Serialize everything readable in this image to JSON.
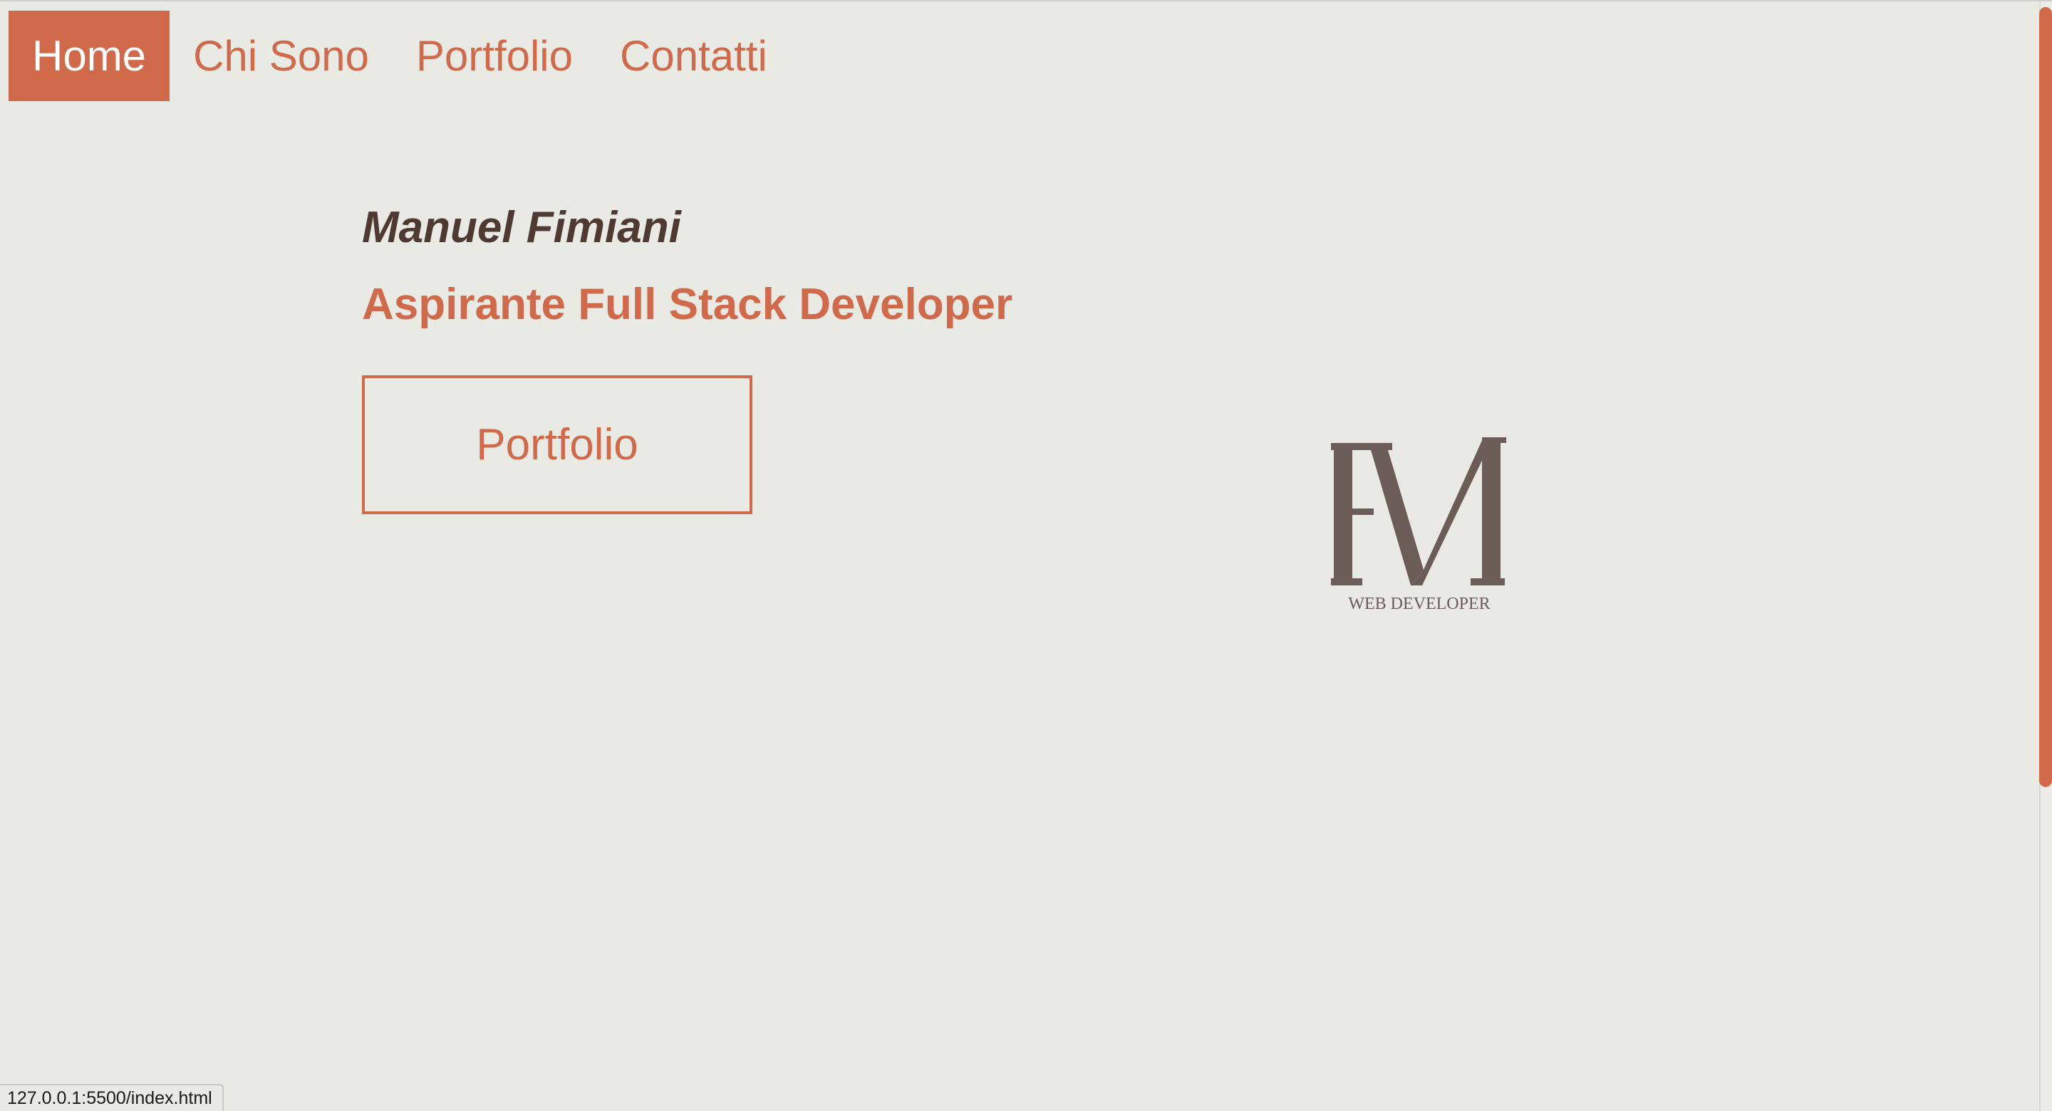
{
  "nav": {
    "items": [
      {
        "label": "Home",
        "active": true
      },
      {
        "label": "Chi Sono",
        "active": false
      },
      {
        "label": "Portfolio",
        "active": false
      },
      {
        "label": "Contatti",
        "active": false
      }
    ]
  },
  "hero": {
    "name": "Manuel Fimiani",
    "role": "Aspirante Full Stack Developer",
    "button_label": "Portfolio"
  },
  "logo": {
    "monogram": "FM",
    "tagline": "WEB DEVELOPER",
    "color": "#6b5c58"
  },
  "status_bar": {
    "url": "127.0.0.1:5500/index.html"
  },
  "colors": {
    "accent": "#d06a4b",
    "background": "#e9eae4",
    "heading_dark": "#4e3a32"
  }
}
